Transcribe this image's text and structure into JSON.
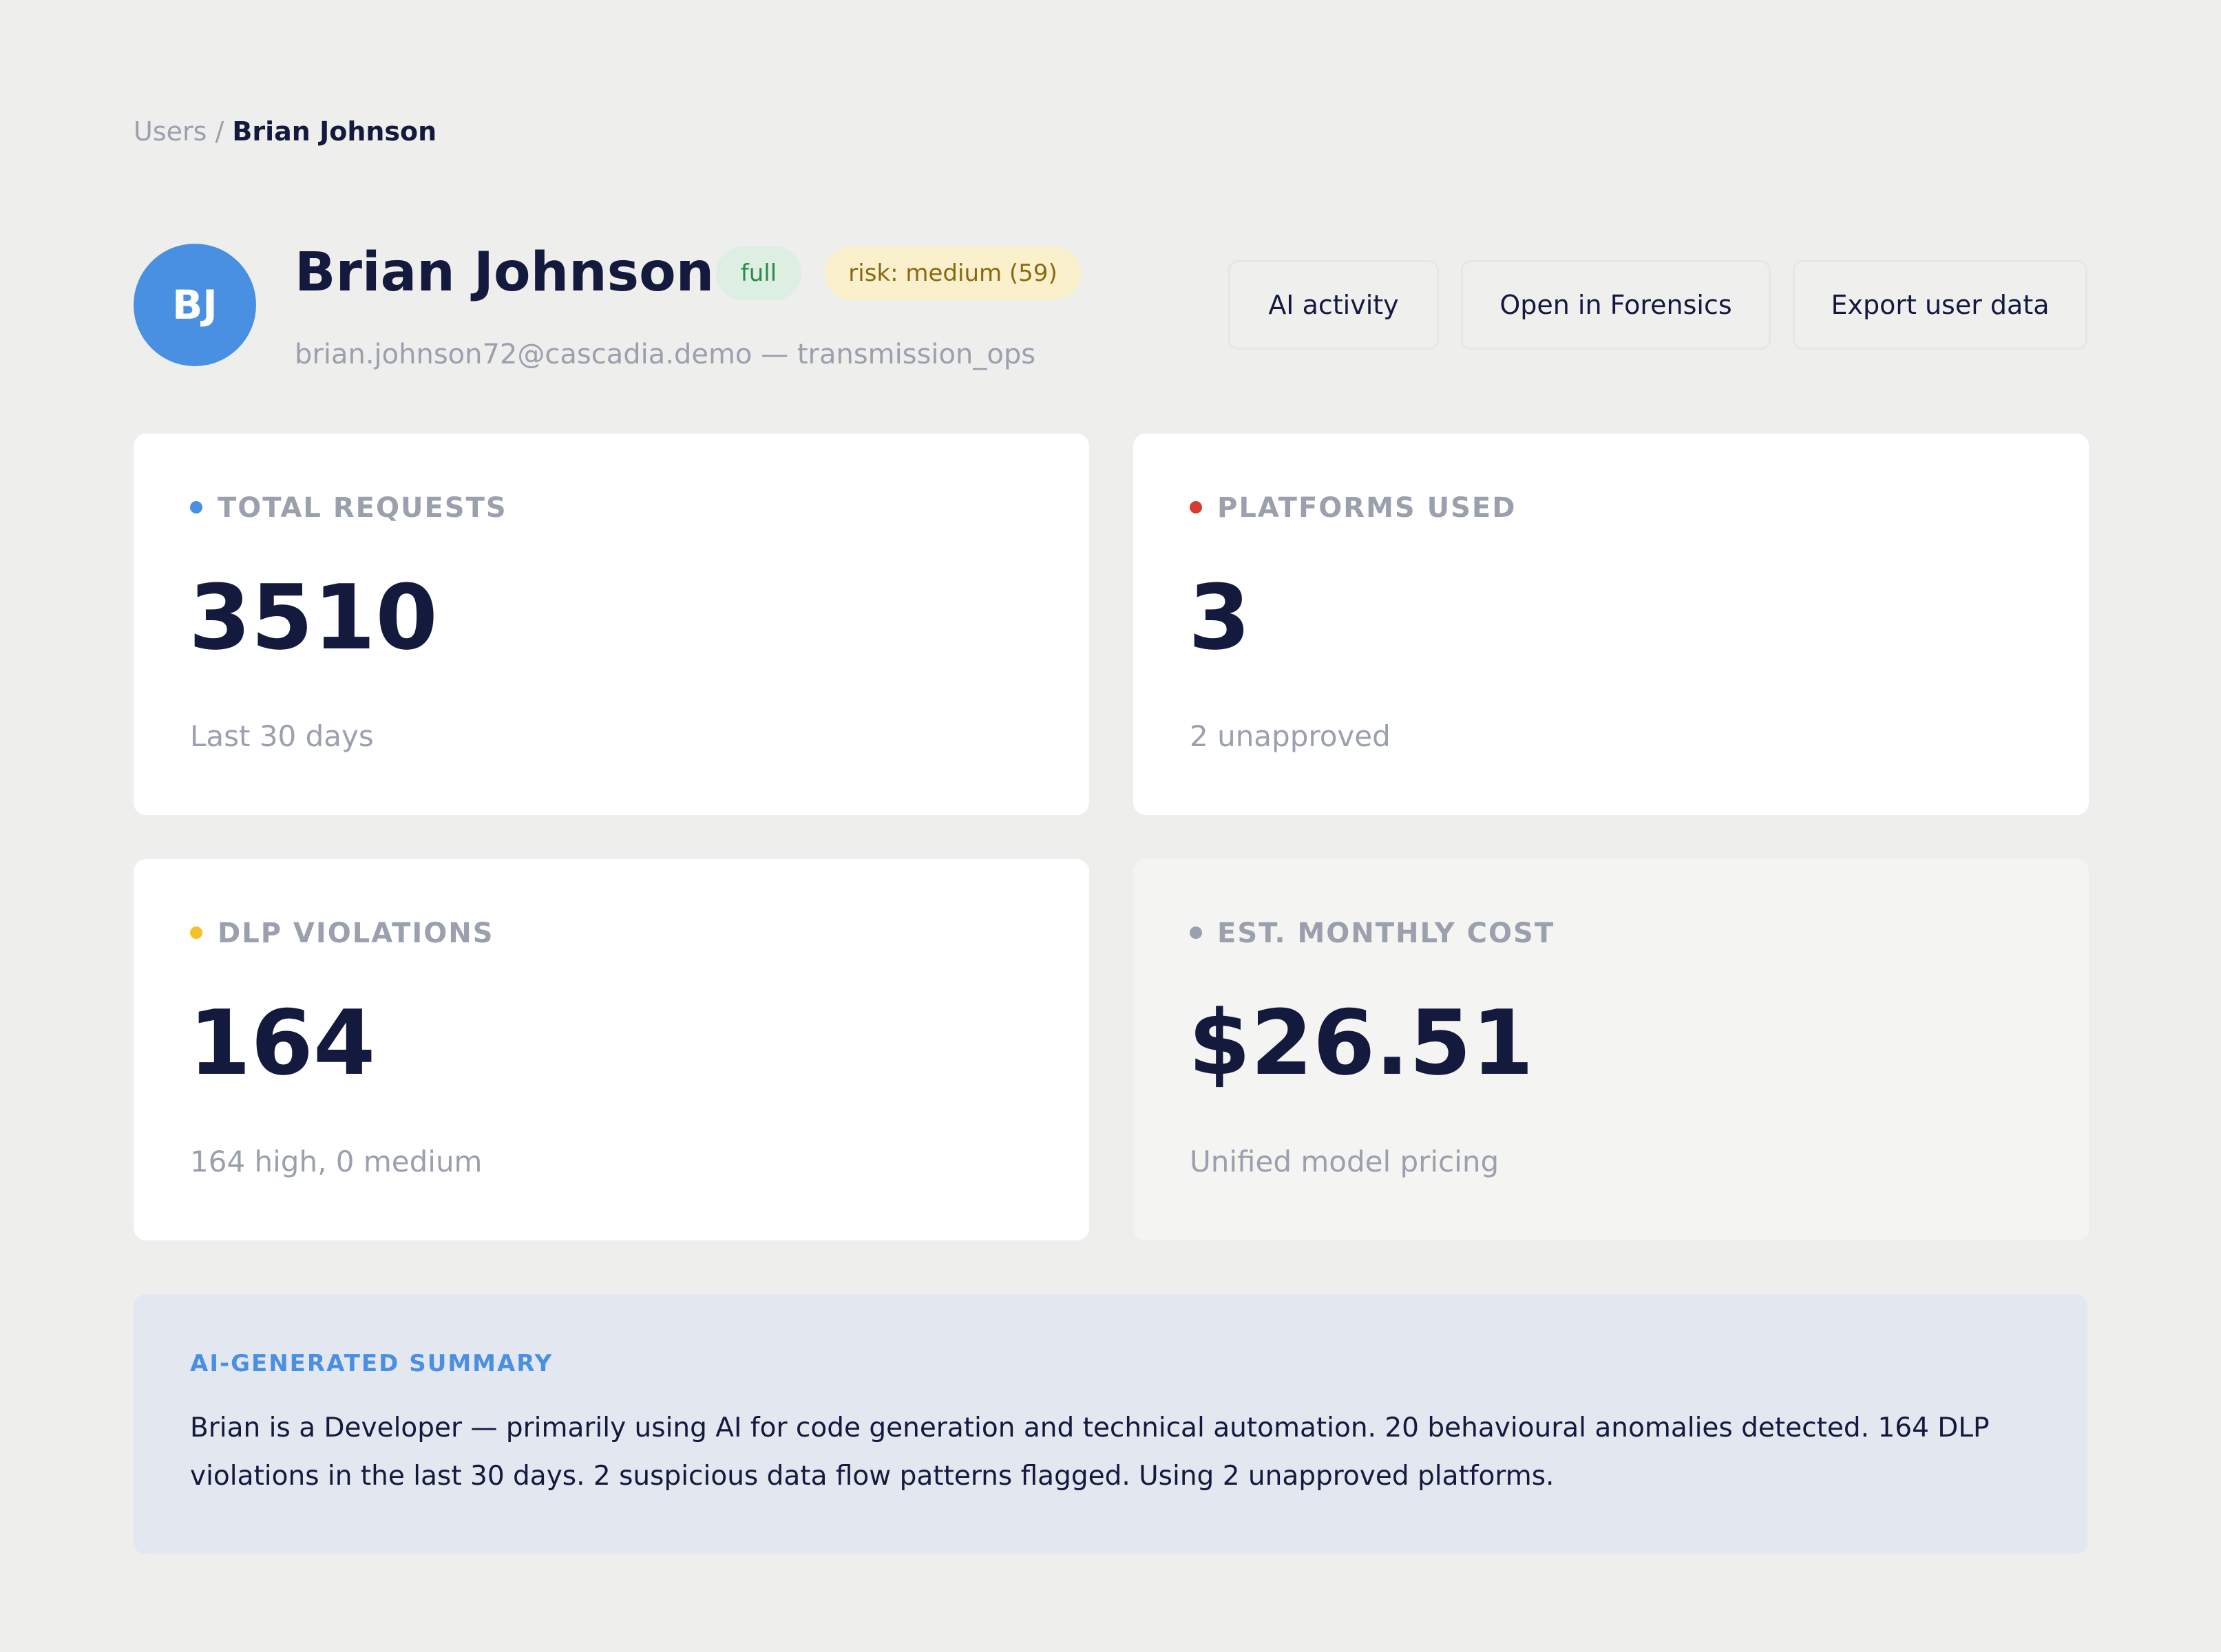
{
  "breadcrumb": {
    "parent": "Users",
    "separator": "/",
    "current": "Brian Johnson"
  },
  "user": {
    "initials": "BJ",
    "name": "Brian Johnson",
    "access_badge": "full",
    "risk_badge": "risk: medium (59)",
    "subtitle": "brian.johnson72@cascadia.demo — transmission_ops",
    "avatar_color": "#4a90e2"
  },
  "actions": {
    "ai_activity": "AI activity",
    "open_forensics": "Open in Forensics",
    "export_data": "Export user data"
  },
  "stats": [
    {
      "label": "TOTAL REQUESTS",
      "value": "3510",
      "sub": "Last 30 days",
      "dot_color": "#4a90e2"
    },
    {
      "label": "PLATFORMS USED",
      "value": "3",
      "sub": "2 unapproved",
      "dot_color": "#d63b32"
    },
    {
      "label": "DLP VIOLATIONS",
      "value": "164",
      "sub": "164 high, 0 medium",
      "dot_color": "#f2c227"
    },
    {
      "label": "EST. MONTHLY COST",
      "value": "$26.51",
      "sub": "Unified model pricing",
      "dot_color": "#9aa0ad"
    }
  ],
  "summary": {
    "heading": "AI-GENERATED SUMMARY",
    "text": "Brian is a Developer — primarily using AI for code generation and technical automation. 20 behavioural anomalies detected. 164 DLP violations in the last 30 days. 2 suspicious data flow patterns flagged. Using 2 unapproved platforms."
  }
}
